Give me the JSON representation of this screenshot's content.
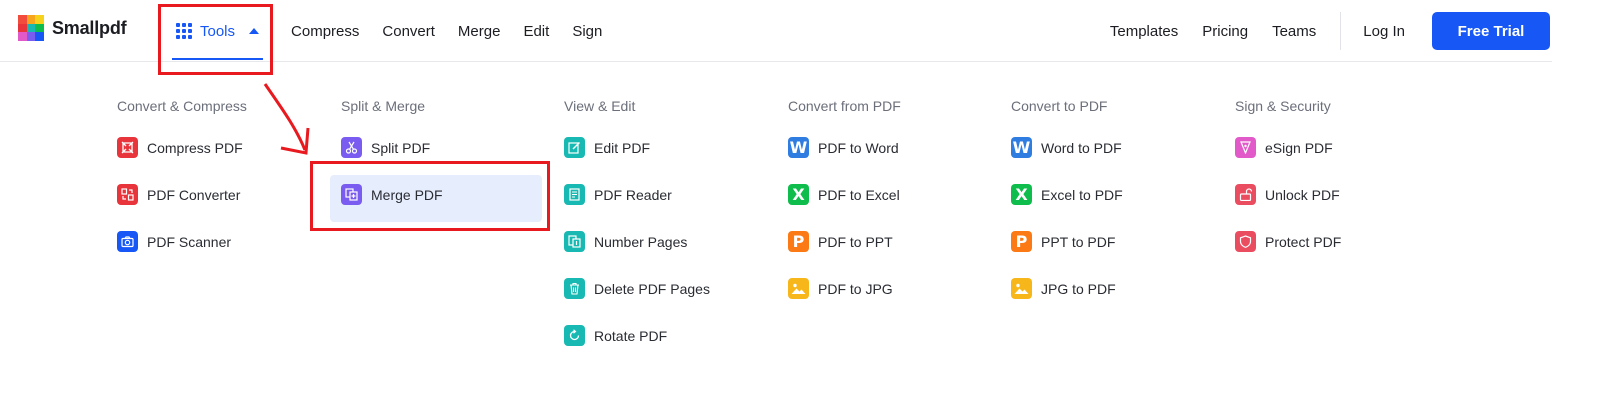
{
  "brand": {
    "name": "Smallpdf"
  },
  "nav": {
    "tools_label": "Tools",
    "links": [
      "Compress",
      "Convert",
      "Merge",
      "Edit",
      "Sign"
    ],
    "right_links": [
      "Templates",
      "Pricing",
      "Teams"
    ],
    "login_label": "Log In",
    "cta_label": "Free Trial"
  },
  "colors": {
    "accent": "#1657f5",
    "red": "#e8343b",
    "blue": "#1657f5",
    "purple": "#7a5cf0",
    "teal": "#18b9b2",
    "word_blue": "#2f7de0",
    "excel_green": "#0fbd4d",
    "ppt_orange": "#fb7a16",
    "jpg_yellow": "#f7b61a",
    "pink": "#e25ac9",
    "rose": "#ea4c60"
  },
  "menu": {
    "columns": [
      {
        "title": "Convert & Compress",
        "items": [
          {
            "label": "Compress PDF",
            "icon": "compress-icon"
          },
          {
            "label": "PDF Converter",
            "icon": "converter-icon"
          },
          {
            "label": "PDF Scanner",
            "icon": "camera-icon"
          }
        ]
      },
      {
        "title": "Split & Merge",
        "items": [
          {
            "label": "Split PDF",
            "icon": "scissors-icon"
          },
          {
            "label": "Merge PDF",
            "icon": "merge-icon",
            "highlighted": true
          }
        ]
      },
      {
        "title": "View & Edit",
        "items": [
          {
            "label": "Edit PDF",
            "icon": "edit-icon"
          },
          {
            "label": "PDF Reader",
            "icon": "reader-icon"
          },
          {
            "label": "Number Pages",
            "icon": "number-pages-icon"
          },
          {
            "label": "Delete PDF Pages",
            "icon": "trash-icon"
          },
          {
            "label": "Rotate PDF",
            "icon": "rotate-icon"
          }
        ]
      },
      {
        "title": "Convert from PDF",
        "items": [
          {
            "label": "PDF to Word",
            "icon": "word-icon",
            "glyph": "W"
          },
          {
            "label": "PDF to Excel",
            "icon": "excel-icon",
            "glyph": "X"
          },
          {
            "label": "PDF to PPT",
            "icon": "ppt-icon",
            "glyph": "P"
          },
          {
            "label": "PDF to JPG",
            "icon": "image-icon"
          }
        ]
      },
      {
        "title": "Convert to PDF",
        "items": [
          {
            "label": "Word to PDF",
            "icon": "word-icon",
            "glyph": "W"
          },
          {
            "label": "Excel to PDF",
            "icon": "excel-icon",
            "glyph": "X"
          },
          {
            "label": "PPT to PDF",
            "icon": "ppt-icon",
            "glyph": "P"
          },
          {
            "label": "JPG to PDF",
            "icon": "image-icon"
          }
        ]
      },
      {
        "title": "Sign & Security",
        "items": [
          {
            "label": "eSign PDF",
            "icon": "pen-nib-icon"
          },
          {
            "label": "Unlock PDF",
            "icon": "unlock-icon"
          },
          {
            "label": "Protect PDF",
            "icon": "shield-icon"
          }
        ]
      }
    ]
  }
}
